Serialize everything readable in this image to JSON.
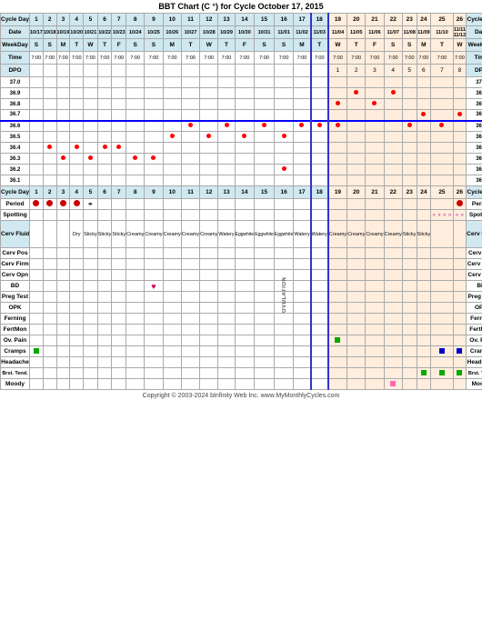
{
  "title": "BBT Chart (C °) for Cycle October 17, 2015",
  "copyright": "Copyright © 2003-2024 bInfinity Web Inc.   www.MyMonthlyCycles.com",
  "header": {
    "cycle_day_label": "Cycle Day",
    "date_label": "Date",
    "weekday_label": "WeekDay",
    "time_label": "Time",
    "dpo_label": "DPO"
  },
  "temp_labels": [
    "37.0",
    "36.9",
    "36.8",
    "36.7",
    "36.6",
    "36.5",
    "36.4",
    "36.3",
    "36.2",
    "36.1"
  ],
  "rows": {
    "period": "Period",
    "spotting": "Spotting",
    "cerv_fluid": "Cerv Fluid",
    "cerv_pos": "Cerv Pos",
    "cerv_firm": "Cerv Firm",
    "cerv_opn": "Cerv Opn",
    "bd": "BD",
    "preg_test": "Preg Test",
    "opk": "OPK",
    "ferning": "Ferning",
    "fertmon": "FertMon",
    "ov_pain": "Ov. Pain",
    "cramps": "Cramps",
    "headache": "Headache",
    "brst_tend": "Brst. Tend.",
    "moody": "Moody"
  }
}
